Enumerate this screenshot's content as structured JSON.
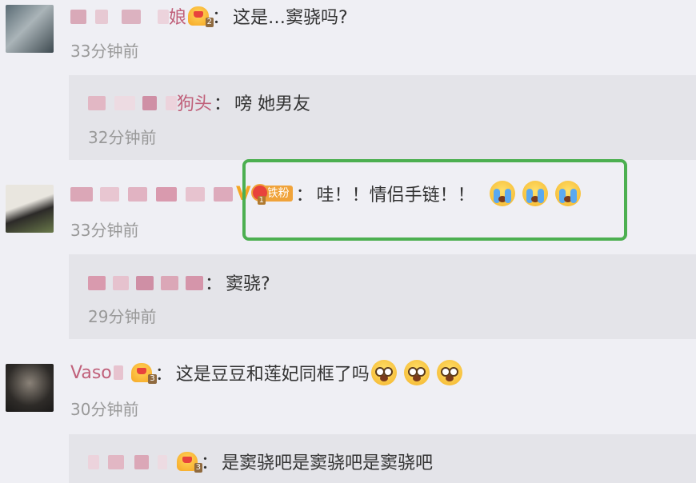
{
  "comments": [
    {
      "name": "娘",
      "badge_level": "2",
      "text": "这是…窦骁吗?",
      "time": "33分钟前",
      "reply": {
        "name": "狗头",
        "text": "嗙 她男友",
        "time": "32分钟前"
      }
    },
    {
      "name_badge": "铁粉",
      "fan_level": "1",
      "vip_mark": "V",
      "text": "哇！！情侣手链！！",
      "time": "33分钟前",
      "emoji": "crying-emoji",
      "reply": {
        "name": "",
        "text": "窦骁?",
        "time": "29分钟前"
      }
    },
    {
      "name": "Vaso",
      "badge_level": "3",
      "text": "这是豆豆和莲妃同框了吗",
      "time": "30分钟前",
      "emoji": "shocked-emoji",
      "reply": {
        "name": "",
        "badge_level": "3",
        "text": "是窦骁吧是窦骁吧是窦骁吧"
      }
    }
  ],
  "colors": {
    "name": "#c0607a",
    "time": "#999999",
    "highlight": "#4caf50",
    "background": "#efeff4",
    "reply_bg": "#e4e4e9"
  }
}
